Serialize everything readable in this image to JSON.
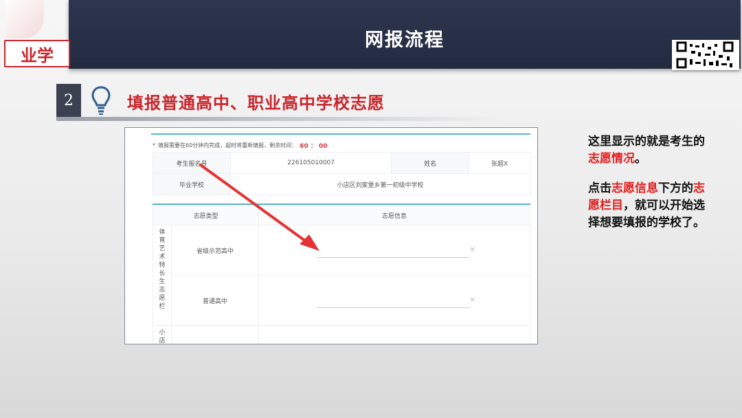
{
  "slide": {
    "title": "网报流程",
    "logo_text": "业学",
    "step_number": "2",
    "step_heading": "填报普通高中、职业高中学校志愿"
  },
  "form": {
    "notice_prefix": "*",
    "notice": "填报需要在60分钟内完成，超时将重新填报，剩余时间：",
    "timer": "60 ： 00",
    "candidate_id_label": "考生报名号",
    "candidate_id_value": "226105010007",
    "name_label": "姓名",
    "name_value": "张超X",
    "school_label": "毕业学校",
    "school_value": "小店区刘家堡乡第一初级中学校",
    "col_type": "志愿类型",
    "col_info": "志愿信息",
    "group1_vertical": [
      "体",
      "育",
      "艺",
      "术",
      "特",
      "长",
      "生",
      "志",
      "愿",
      "栏"
    ],
    "group2_vertical": [
      "小",
      "店"
    ],
    "row1_type": "省级示范高中",
    "row2_type": "普通高中",
    "clear_symbol": "×"
  },
  "note": {
    "line1_a": "这里显示的就是考生的",
    "line1_red": "志愿情况",
    "line1_b": "。",
    "line2_a": "点击",
    "line2_red1": "志愿信息",
    "line2_b": "下方的",
    "line2_red2": "志愿栏目",
    "line2_c": "，就可以开始选择想要填报的学校了。"
  },
  "colors": {
    "header": "#2e3650",
    "accent_red": "#c8252b",
    "highlight_red": "#e02020",
    "table_rule": "#5ab3c9"
  },
  "icons": [
    "lightbulb-icon",
    "qr-code",
    "arrow-pointer",
    "clear-icon"
  ]
}
